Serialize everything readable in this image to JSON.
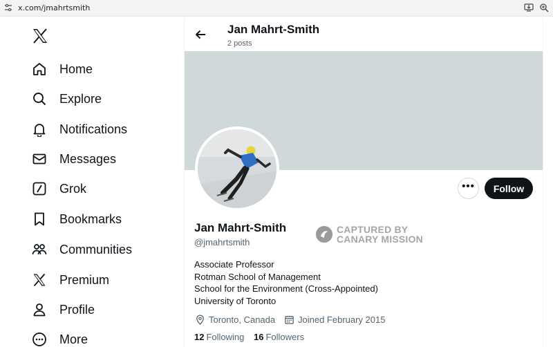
{
  "browser": {
    "url": "x.com/jmahrtsmith",
    "icons": [
      "site-settings-icon",
      "install-icon",
      "zoom-icon"
    ]
  },
  "sidebar": {
    "logo": "x-logo-icon",
    "items": [
      {
        "label": "Home",
        "icon": "home-icon"
      },
      {
        "label": "Explore",
        "icon": "search-icon"
      },
      {
        "label": "Notifications",
        "icon": "bell-icon"
      },
      {
        "label": "Messages",
        "icon": "envelope-icon"
      },
      {
        "label": "Grok",
        "icon": "grok-icon"
      },
      {
        "label": "Bookmarks",
        "icon": "bookmark-icon"
      },
      {
        "label": "Communities",
        "icon": "communities-icon"
      },
      {
        "label": "Premium",
        "icon": "x-premium-icon"
      },
      {
        "label": "Profile",
        "icon": "person-icon"
      },
      {
        "label": "More",
        "icon": "more-circle-icon"
      }
    ]
  },
  "header": {
    "name": "Jan Mahrt-Smith",
    "posts": "2 posts"
  },
  "profile": {
    "name": "Jan Mahrt-Smith",
    "handle": "@jmahrtsmith",
    "follow_label": "Follow",
    "more_label": "•••",
    "bio": [
      "Associate Professor",
      "Rotman School of Management",
      "School for the Environment (Cross-Appointed)",
      "University of Toronto"
    ],
    "location": "Toronto, Canada",
    "joined": "Joined February 2015",
    "following_count": "12",
    "following_label": "Following",
    "followers_count": "16",
    "followers_label": "Followers"
  },
  "watermark": {
    "line1": "CAPTURED BY",
    "line2": "CANARY MISSION"
  },
  "colors": {
    "banner": "#cfd9da",
    "follow_button": "#0f1419",
    "secondary_text": "#536471"
  }
}
